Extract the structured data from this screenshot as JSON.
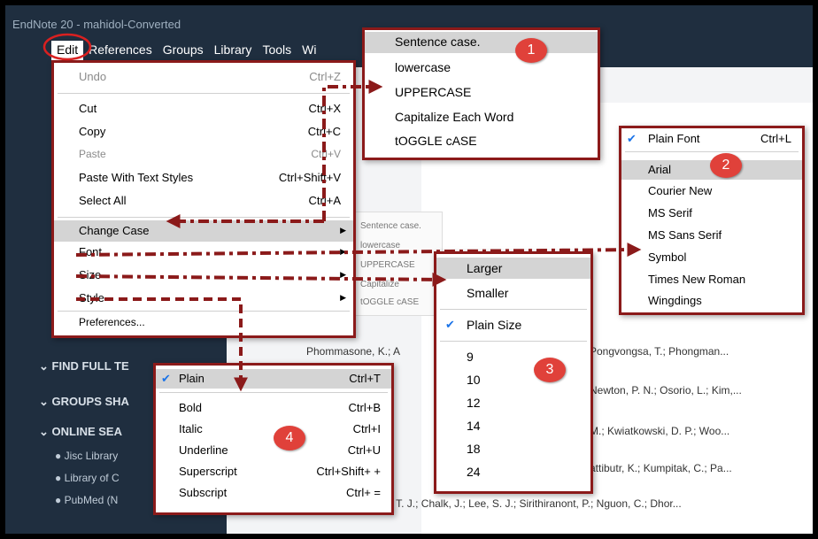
{
  "app": {
    "title": "EndNote 20 - mahidol-Converted",
    "menubar": [
      "Edit",
      "References",
      "Groups",
      "Library",
      "Tools",
      "Wi"
    ]
  },
  "edit_menu": {
    "items": [
      {
        "label": "Undo",
        "shortcut": "Ctrl+Z",
        "disabled": true
      },
      {
        "label": "Cut",
        "shortcut": "Ctrl+X"
      },
      {
        "label": "Copy",
        "shortcut": "Ctrl+C"
      },
      {
        "label": "Paste",
        "shortcut": "Ctrl+V",
        "disabled": true
      },
      {
        "label": "Paste With Text Styles",
        "shortcut": "Ctrl+Shift+V"
      },
      {
        "label": "Select All",
        "shortcut": "Ctrl+A"
      },
      {
        "label": "Change Case",
        "submenu": true
      },
      {
        "label": "Font",
        "submenu": true
      },
      {
        "label": "Size",
        "submenu": true
      },
      {
        "label": "Style",
        "submenu": true
      },
      {
        "label": "Preferences..."
      }
    ]
  },
  "case_menu": {
    "items": [
      "Sentence case.",
      "lowercase",
      "UPPERCASE",
      "Capitalize Each Word",
      "tOGGLE cASE"
    ],
    "badge": "1"
  },
  "font_menu": {
    "items": [
      {
        "label": "Plain Font",
        "shortcut": "Ctrl+L",
        "checked": true
      },
      {
        "label": "Arial"
      },
      {
        "label": "Courier New"
      },
      {
        "label": "MS Serif"
      },
      {
        "label": "MS Sans Serif"
      },
      {
        "label": "Symbol"
      },
      {
        "label": "Times New Roman"
      },
      {
        "label": "Wingdings"
      }
    ],
    "badge": "2"
  },
  "size_menu": {
    "items": [
      "Larger",
      "Smaller",
      "Plain Size",
      "9",
      "10",
      "12",
      "14",
      "18",
      "24"
    ],
    "badge": "3"
  },
  "style_menu": {
    "items": [
      {
        "label": "Plain",
        "shortcut": "Ctrl+T",
        "checked": true
      },
      {
        "label": "Bold",
        "shortcut": "Ctrl+B"
      },
      {
        "label": "Italic",
        "shortcut": "Ctrl+I"
      },
      {
        "label": "Underline",
        "shortcut": "Ctrl+U"
      },
      {
        "label": "Superscript",
        "shortcut": "Ctrl+Shift+ +"
      },
      {
        "label": "Subscript",
        "shortcut": "Ctrl+ ="
      }
    ],
    "badge": "4"
  },
  "ghost_case_menu": [
    "Sentence case.",
    "lowercase",
    "UPPERCASE",
    "Capitalize",
    "tOGGLE cASE"
  ],
  "sidebar": {
    "headings": [
      "FIND FULL TE",
      "GROUPS SHA",
      "ONLINE SEA"
    ],
    "online_items": [
      "Jisc Library",
      "Library of C",
      "PubMed (N"
    ]
  },
  "references": [
    "Phommasone, K.; A",
    "Pongvongsa, T.; Phongman...",
    "Newton, P. N.; Osorio, L.; Kim,...",
    "M.; Kwiatkowski, D. P.; Woo...",
    "attibutr, K.; Kumpitak, C.; Pa...",
    "o, T. J.; Chalk, J.; Lee, S. J.; Sirithiranont, P.; Nguon, C.; Dhor..."
  ],
  "colors": {
    "accent": "#8b1a1a",
    "badge": "#e0413a",
    "check": "#1a73e8"
  }
}
